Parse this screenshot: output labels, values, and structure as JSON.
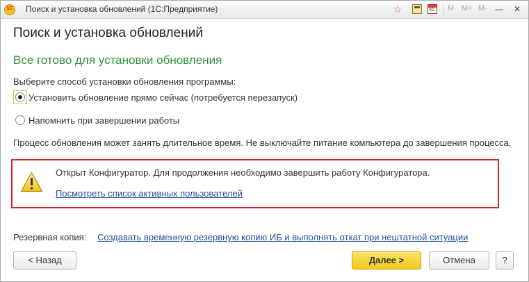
{
  "titlebar": {
    "logo_text": "1С",
    "title": "Поиск и установка обновлений  (1С:Предприятие)",
    "memory_buttons": [
      "M",
      "M+",
      "M-"
    ],
    "calendar_day": "31"
  },
  "page": {
    "title": "Поиск и установка обновлений",
    "heading": "Все готово для установки обновления",
    "prompt": "Выберите способ установки обновления программы:",
    "options": [
      {
        "label": "Установить обновление прямо сейчас (потребуется перезапуск)",
        "selected": true
      },
      {
        "label": "Напомнить при завершении работы",
        "selected": false
      }
    ],
    "info": "Процесс обновления может занять длительное время. Не выключайте питание компьютера до завершения процесса."
  },
  "warning": {
    "text": "Открыт Конфигуратор. Для продолжения необходимо завершить работу Конфигуратора.",
    "link": "Посмотреть список активных пользователей"
  },
  "backup": {
    "label": "Резервная копия:",
    "link": "Создавать временную резервную копию ИБ и выполнять откат при нештатной ситуации"
  },
  "buttons": {
    "back": "< Назад",
    "next": "Далее >",
    "cancel": "Отмена",
    "help": "?"
  },
  "colors": {
    "heading": "#2f8f3c",
    "link": "#1f4e9e",
    "warning_border": "#d0282f",
    "primary_button": "#f2c81c"
  }
}
